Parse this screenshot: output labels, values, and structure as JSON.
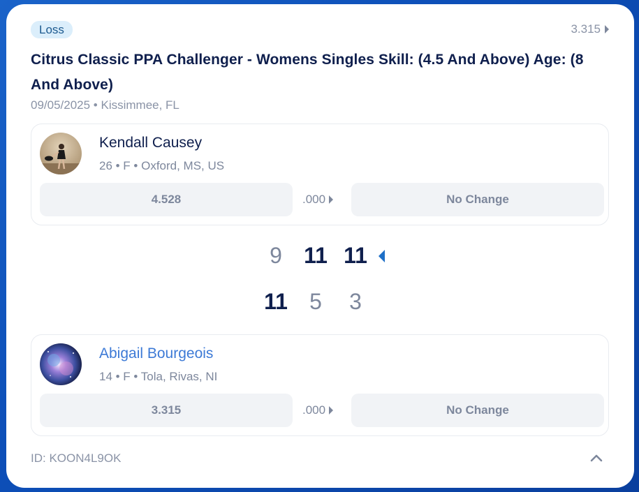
{
  "result_badge": "Loss",
  "opponent_rating_link": "3.315",
  "event": {
    "title": "Citrus Classic PPA Challenger - Womens Singles Skill: (4.5 And Above) Age: (8 And Above)",
    "meta": "09/05/2025 • Kissimmee, FL"
  },
  "player1": {
    "name": "Kendall Causey",
    "info": "26 • F • Oxford, MS, US",
    "rating": "4.528",
    "delta": ".000",
    "change": "No Change"
  },
  "player2": {
    "name": "Abigail Bourgeois",
    "info": "14 • F • Tola, Rivas, NI",
    "rating": "3.315",
    "delta": ".000",
    "change": "No Change"
  },
  "scores": {
    "top": [
      "9",
      "11",
      "11"
    ],
    "bottom": [
      "11",
      "5",
      "3"
    ]
  },
  "footer": {
    "id_text": "ID: KOON4L9OK"
  },
  "colors": {
    "accent": "#1e6fc7",
    "title": "#0f1f4d",
    "muted": "#7d879c",
    "badge_bg": "#dbeefb"
  }
}
